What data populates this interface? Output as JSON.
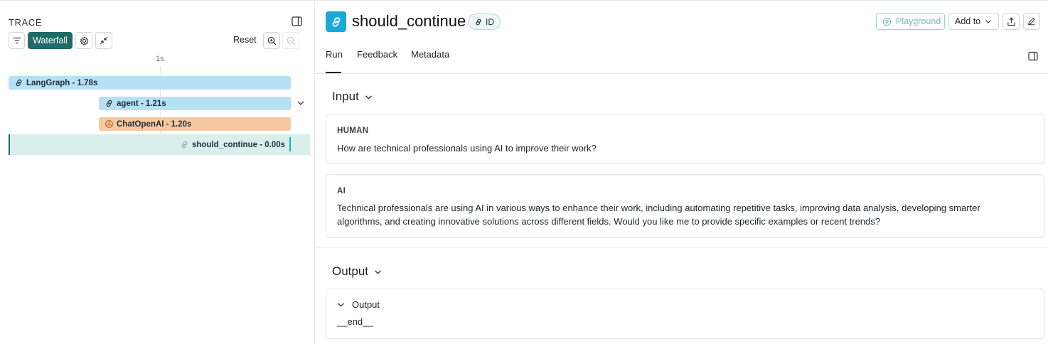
{
  "trace_panel": {
    "title": "TRACE",
    "toolbar": {
      "view_label": "Waterfall",
      "reset_label": "Reset"
    },
    "axis_tick": "1s",
    "runs": [
      {
        "label": "LangGraph - 1.78s",
        "icon": "link-icon",
        "color": "#b7e0f5"
      },
      {
        "label": "agent - 1.21s",
        "icon": "link-icon",
        "color": "#b7e0f5"
      },
      {
        "label": "ChatOpenAI - 1.20s",
        "icon": "openai-icon",
        "color": "#f5c9a0"
      },
      {
        "label": "should_continue - 0.00s",
        "icon": "link-icon",
        "selected": true
      }
    ]
  },
  "run_detail": {
    "title": "should_continue",
    "id_badge": "ID",
    "actions": {
      "playground": "Playground",
      "add_to": "Add to"
    },
    "tabs": [
      "Run",
      "Feedback",
      "Metadata"
    ],
    "active_tab": "Run",
    "input": {
      "heading": "Input",
      "messages": [
        {
          "role": "HUMAN",
          "text": "How are technical professionals using AI to improve their work?"
        },
        {
          "role": "AI",
          "text": "Technical professionals are using AI in various ways to enhance their work, including automating repetitive tasks, improving data analysis, developing smarter algorithms, and creating innovative solutions across different fields. Would you like me to provide specific examples or recent trends?"
        }
      ]
    },
    "output": {
      "heading": "Output",
      "field_label": "Output",
      "value": "__end__"
    }
  },
  "colors": {
    "accent": "#1f6b67",
    "run_icon": "#1aa8d8",
    "selected_row": "#d8efec"
  }
}
